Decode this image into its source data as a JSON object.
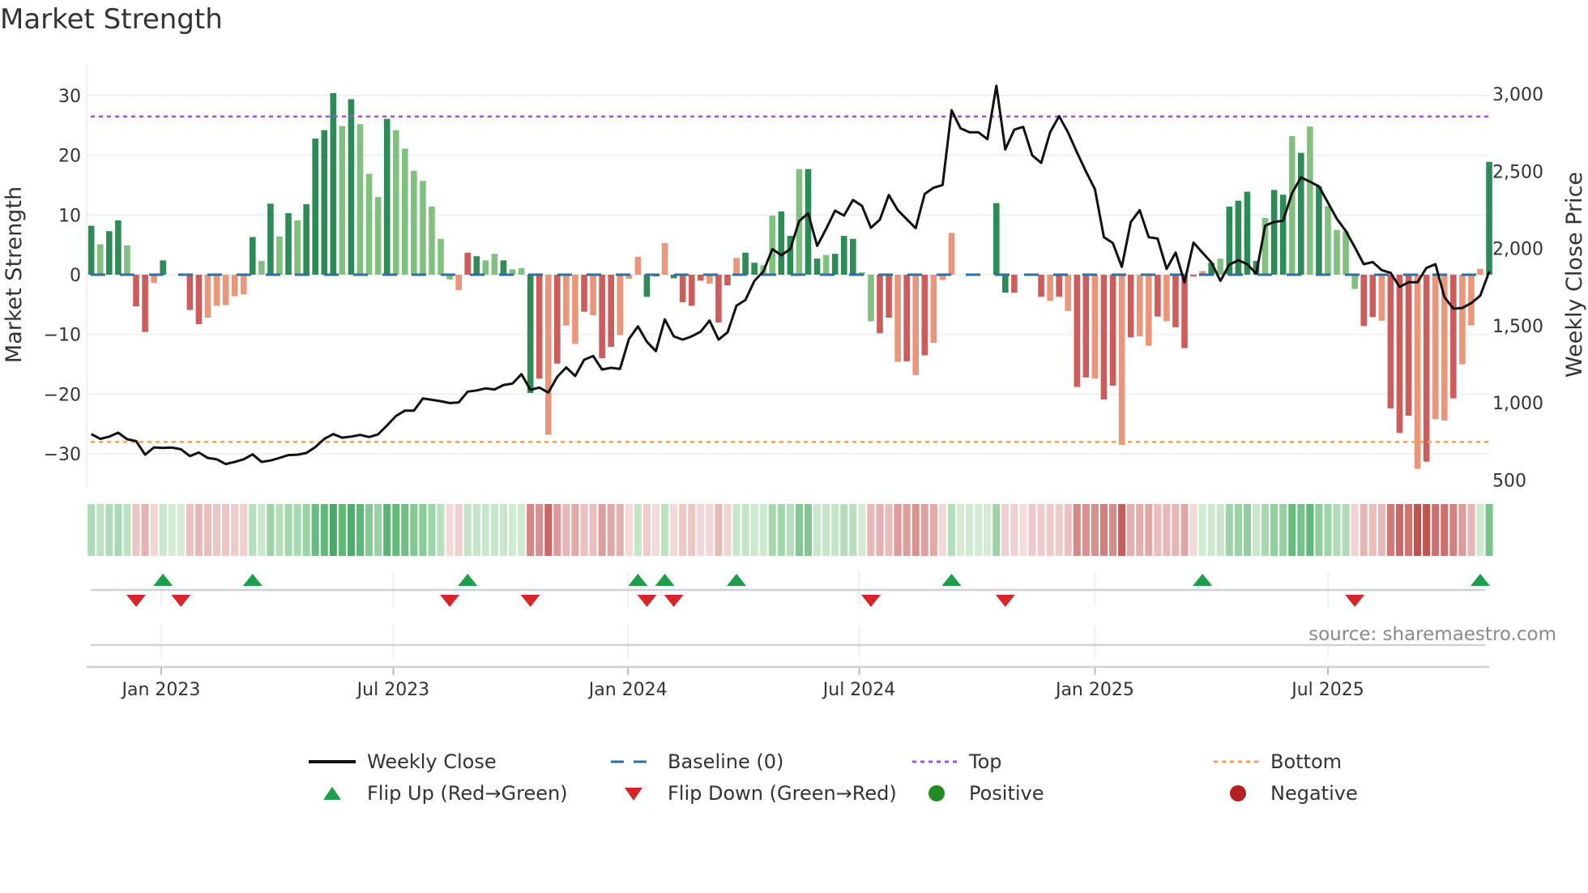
{
  "title": "Market Strength",
  "source": "source: sharemaestro.com",
  "colors": {
    "strong_green": "#2e8b57",
    "light_green": "#82c07f",
    "strong_red": "#cd5c5c",
    "light_red": "#e9967a",
    "baseline": "#2e6fa0",
    "top": "#9b59d6",
    "bottom": "#f0a060",
    "close": "#111111",
    "flip_up": "#1e9e4a",
    "flip_down": "#d62728",
    "positive": "#228b22",
    "negative": "#b22222"
  },
  "legend": {
    "weekly_close": "Weekly Close",
    "baseline": "Baseline (0)",
    "top": "Top",
    "bottom": "Bottom",
    "flip_up": "Flip Up (Red→Green)",
    "flip_down": "Flip Down (Green→Red)",
    "positive": "Positive",
    "negative": "Negative"
  },
  "chart_data": {
    "type": "bar",
    "title": "Market Strength",
    "ylabel": "Market Strength",
    "y2label": "Weekly Close Price",
    "ylim": [
      -35,
      35
    ],
    "y2lim": [
      450,
      3150
    ],
    "yticks": [
      {
        "v": 30,
        "label": "30"
      },
      {
        "v": 20,
        "label": "20"
      },
      {
        "v": 10,
        "label": "10"
      },
      {
        "v": 0,
        "label": "0"
      },
      {
        "v": -10,
        "label": "−10"
      },
      {
        "v": -20,
        "label": "−20"
      },
      {
        "v": -30,
        "label": "−30"
      }
    ],
    "y2ticks": [
      {
        "v": 3000,
        "label": "3,000"
      },
      {
        "v": 2500,
        "label": "2,500"
      },
      {
        "v": 2000,
        "label": "2,000"
      },
      {
        "v": 1500,
        "label": "1,500"
      },
      {
        "v": 1000,
        "label": "1,000"
      },
      {
        "v": 500,
        "label": "500"
      }
    ],
    "xticks": [
      {
        "week": 7.8,
        "label": "Jan 2023"
      },
      {
        "week": 33.7,
        "label": "Jul 2023"
      },
      {
        "week": 59.9,
        "label": "Jan 2024"
      },
      {
        "week": 85.7,
        "label": "Jul 2024"
      },
      {
        "week": 112.0,
        "label": "Jan 2025"
      },
      {
        "week": 138.0,
        "label": "Jul 2025"
      }
    ],
    "top_level": 26.5,
    "bottom_level": -28.0,
    "grid": true,
    "legend_position": "bottom",
    "strength": [
      8.2,
      5.1,
      7.3,
      9.1,
      4.9,
      -5.3,
      -9.6,
      -1.4,
      2.4,
      0,
      0,
      -5.9,
      -8.3,
      -7.2,
      -5.2,
      -5.1,
      -3.6,
      -3.3,
      6.3,
      2.3,
      11.9,
      6.4,
      10.3,
      9.1,
      11.8,
      22.8,
      24.2,
      30.4,
      24.9,
      29.4,
      25.2,
      16.9,
      13.0,
      26.1,
      24.2,
      21.1,
      17.4,
      15.7,
      11.4,
      6.0,
      -0.8,
      -2.6,
      3.7,
      3.1,
      2.4,
      3.5,
      2.4,
      0.9,
      1.1,
      -19.8,
      -17.4,
      -26.8,
      -14.9,
      -8.5,
      -11.6,
      -6.2,
      -6.8,
      -14.0,
      -12.1,
      -10.1,
      -0.7,
      3.0,
      -3.7,
      -0.3,
      5.3,
      -0.6,
      -4.6,
      -5.2,
      -1.0,
      -1.5,
      -8.0,
      -1.8,
      2.8,
      3.7,
      2.0,
      1.6,
      9.9,
      10.6,
      6.5,
      17.7,
      17.7,
      2.7,
      3.3,
      3.5,
      6.5,
      6.0,
      0.4,
      -7.8,
      -9.8,
      -7.2,
      -14.6,
      -14.5,
      -16.8,
      -13.5,
      -11.4,
      -0.9,
      7.0,
      0,
      1.0,
      0,
      0.3,
      12.0,
      -3.0,
      -3.0,
      0,
      -3.9,
      -3.7,
      -4.4,
      -3.7,
      -6.1,
      -18.8,
      -17.2,
      -17.4,
      -20.9,
      -18.6,
      -28.5,
      -10.5,
      -10.3,
      -11.9,
      -7.0,
      -7.8,
      -8.8,
      -12.3,
      -0.3,
      0.6,
      2.0,
      2.7,
      11.4,
      12.4,
      13.9,
      2.3,
      9.5,
      14.2,
      13.4,
      23.2,
      20.4,
      24.8,
      14.8,
      11.5,
      7.5,
      7.3,
      -2.4,
      -8.6,
      -7.1,
      -7.7,
      -22.4,
      -26.5,
      -23.6,
      -32.5,
      -31.3,
      -24.2,
      -24.4,
      -20.7,
      -15.0,
      -8.5,
      1.0,
      18.9
    ],
    "strength_kind": "GgGGgRRrG--RRrrrrrGgGgGgGGGGgGgggGgggggggrRGggGggGRrRrrRrRRrrrGRrGRRRrRRrGGggGGgGGgGGGggRRrRrRrrrG-G-GGRR-RrRrRRrRRrRrrRrRRRrGgGGGGgGGgGgGggggRRrRRRrRrrRrrrGG",
    "weekly_close": [
      798,
      767,
      782,
      807,
      765,
      753,
      665,
      712,
      709,
      711,
      700,
      656,
      679,
      644,
      635,
      604,
      618,
      635,
      667,
      618,
      627,
      644,
      662,
      665,
      676,
      714,
      767,
      798,
      775,
      782,
      793,
      779,
      796,
      854,
      915,
      950,
      950,
      1029,
      1020,
      1011,
      999,
      1003,
      1073,
      1081,
      1094,
      1087,
      1116,
      1125,
      1186,
      1085,
      1099,
      1067,
      1169,
      1230,
      1174,
      1279,
      1304,
      1216,
      1227,
      1220,
      1414,
      1496,
      1396,
      1335,
      1541,
      1431,
      1410,
      1431,
      1461,
      1533,
      1410,
      1457,
      1629,
      1667,
      1790,
      1851,
      1996,
      1956,
      1996,
      2178,
      2227,
      2017,
      2126,
      2245,
      2213,
      2314,
      2276,
      2134,
      2187,
      2346,
      2248,
      2189,
      2131,
      2353,
      2393,
      2411,
      2895,
      2778,
      2752,
      2752,
      2708,
      3053,
      2641,
      2769,
      2787,
      2603,
      2554,
      2752,
      2857,
      2752,
      2621,
      2498,
      2384,
      2073,
      2035,
      1881,
      2171,
      2248,
      2073,
      2064,
      1868,
      1973,
      1781,
      2038,
      1973,
      1909,
      1790,
      1895,
      1924,
      1898,
      1837,
      2148,
      2171,
      2180,
      2358,
      2460,
      2432,
      2402,
      2297,
      2192,
      2113,
      2008,
      1898,
      1912,
      1860,
      1842,
      1751,
      1781,
      1781,
      1874,
      1898,
      1685,
      1610,
      1615,
      1646,
      1694,
      1851
    ],
    "flip_up_weeks": [
      8,
      18,
      42,
      61,
      64,
      72,
      96,
      124,
      155
    ],
    "flip_down_weeks": [
      5,
      10,
      40,
      49,
      62,
      65,
      87,
      102,
      141
    ]
  }
}
